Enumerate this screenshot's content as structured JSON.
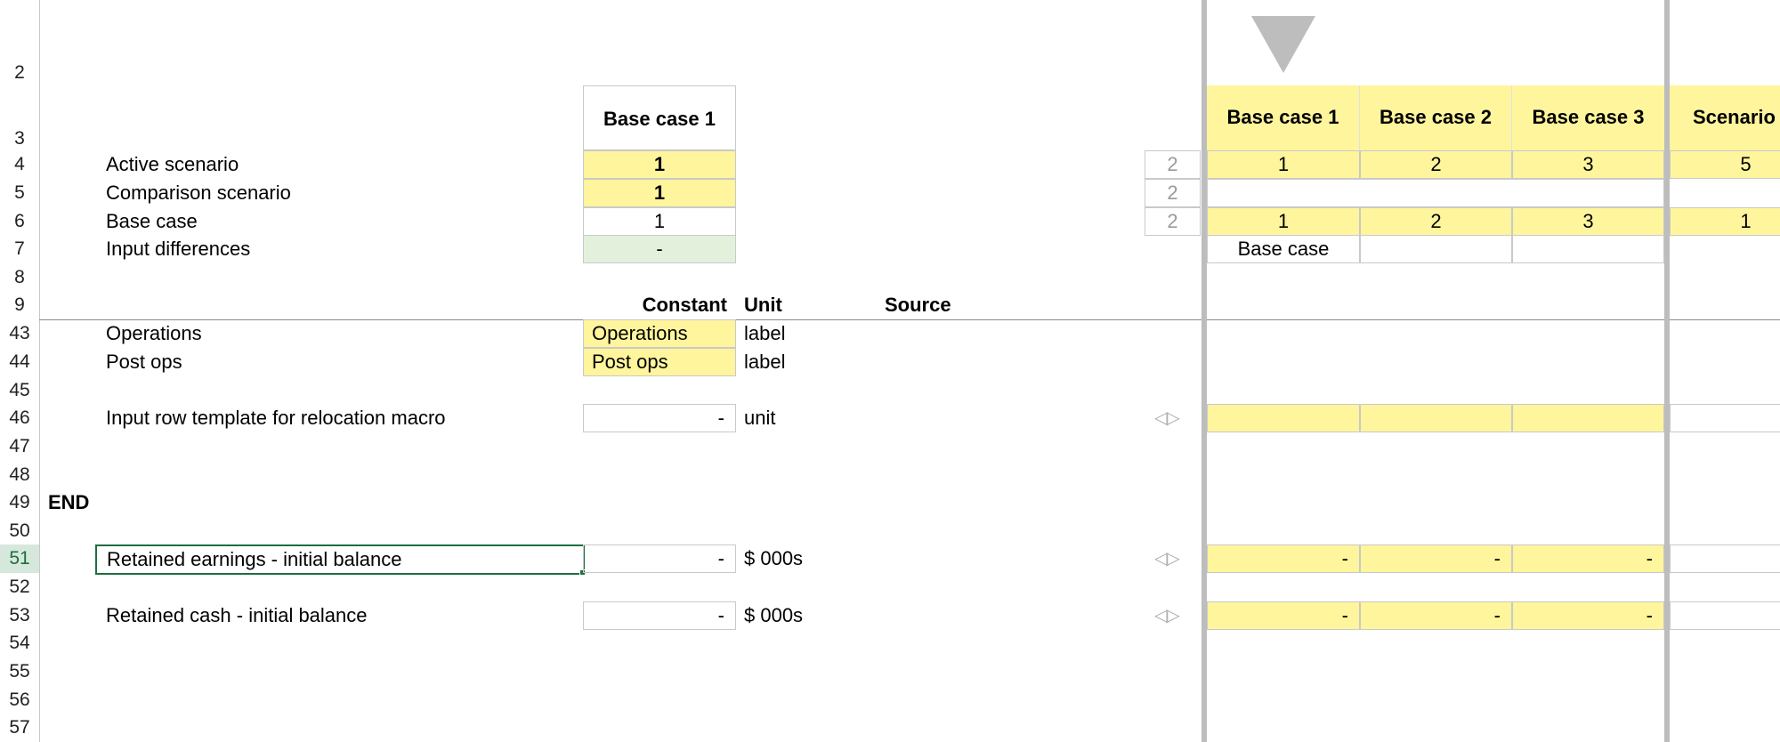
{
  "row_numbers": [
    "2",
    "3",
    "4",
    "5",
    "6",
    "7",
    "8",
    "9",
    "43",
    "44",
    "45",
    "46",
    "47",
    "48",
    "49",
    "50",
    "51",
    "52",
    "53",
    "54",
    "55",
    "56",
    "57"
  ],
  "selected_row": "51",
  "labels": {
    "active_scenario": "Active scenario",
    "comparison_scenario": "Comparison scenario",
    "base_case": "Base case",
    "input_differences": "Input differences",
    "operations": "Operations",
    "post_ops": "Post ops",
    "input_row_template": "Input row template for relocation macro",
    "end": "END",
    "retained_earnings": "Retained earnings - initial balance",
    "retained_cash": "Retained cash - initial balance"
  },
  "main_header": "Base case 1",
  "main_values": {
    "active_scenario": "1",
    "comparison_scenario": "1",
    "base_case": "1",
    "input_differences": "-"
  },
  "column_headers": {
    "constant": "Constant",
    "unit": "Unit",
    "source": "Source"
  },
  "constants": {
    "operations": "Operations",
    "post_ops": "Post ops",
    "input_row_template": "-",
    "retained_earnings": "-",
    "retained_cash": "-"
  },
  "units": {
    "operations": "label",
    "post_ops": "label",
    "input_row_template": "unit",
    "retained_earnings": "$ 000s",
    "retained_cash": "$ 000s"
  },
  "count_col": {
    "active_scenario": "2",
    "comparison_scenario": "2",
    "base_case": "2"
  },
  "scenarios": {
    "headers": [
      "Base case 1",
      "Base case 2",
      "Base case 3",
      "Scenario"
    ],
    "active_scenario": [
      "1",
      "2",
      "3",
      "5"
    ],
    "base_case": [
      "1",
      "2",
      "3",
      "1"
    ],
    "input_differences": [
      "Base case",
      "",
      ""
    ],
    "retained_earnings": [
      "-",
      "-",
      "-"
    ],
    "retained_cash": [
      "-",
      "-",
      "-"
    ]
  },
  "icons": {
    "dropdown": "triangle-down-icon",
    "row_arrows": "left-right-arrows-icon"
  },
  "colors": {
    "input_yellow": "#fff59d",
    "diff_green": "#e3f1dc",
    "selection_green": "#1e6e3f"
  }
}
